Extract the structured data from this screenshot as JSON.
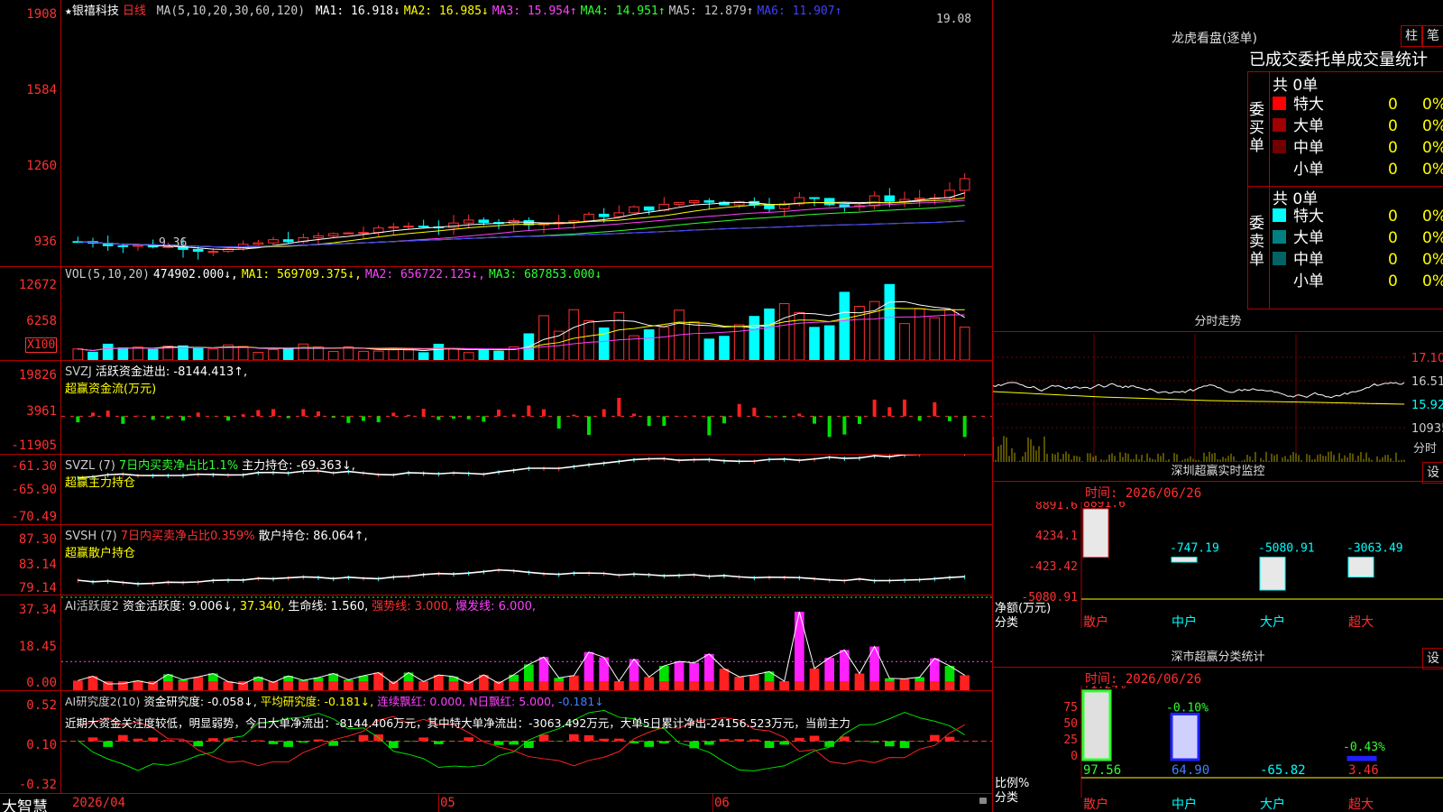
{
  "stock": {
    "name": "★银禧科技",
    "period": "日线",
    "ma_prefix": "MA(5,10,20,30,60,120)",
    "ma_values": [
      {
        "label": "MA1: 16.918↓",
        "color": "#ffffff"
      },
      {
        "label": "MA2: 16.985↓",
        "color": "#ffff00"
      },
      {
        "label": "MA3: 15.954↑",
        "color": "#ff40ff"
      },
      {
        "label": "MA4: 14.951↑",
        "color": "#30ff30"
      },
      {
        "label": "MA5: 12.879↑",
        "color": "#c8c8c8"
      },
      {
        "label": "MA6: 11.907↑",
        "color": "#4040ff"
      }
    ],
    "high_mark": "19.08",
    "low_mark": "9.36",
    "y_ticks": [
      "1908",
      "1584",
      "1260",
      "936"
    ]
  },
  "volume": {
    "legend": [
      {
        "label": "VOL(5,10,20)",
        "color": "#cccccc"
      },
      {
        "label": "474902.000↓,",
        "color": "#ffffff"
      },
      {
        "label": "MA1: 569709.375↓,",
        "color": "#ffff00"
      },
      {
        "label": "MA2: 656722.125↓,",
        "color": "#ff40ff"
      },
      {
        "label": "MA3: 687853.000↓",
        "color": "#30ff30"
      }
    ],
    "y_ticks": [
      "12672",
      "6258"
    ],
    "unit": "X100"
  },
  "svzj": {
    "legend1": [
      {
        "label": "SVZJ",
        "color": "#cccccc"
      },
      {
        "label": "活跃资金进出: -8144.413↑,",
        "color": "#ffffff"
      }
    ],
    "legend2": "超赢资金流(万元)",
    "y_ticks": [
      "19826",
      "3961",
      "-11905"
    ]
  },
  "svzl": {
    "legend1": [
      {
        "label": "SVZL (7)",
        "color": "#cccccc"
      },
      {
        "label": "7日内买卖净占比1.1%",
        "color": "#30ff30"
      },
      {
        "label": "主力持仓: -69.363↓,",
        "color": "#ffffff"
      }
    ],
    "legend2": "超赢主力持仓",
    "y_ticks": [
      "-61.30",
      "-65.90",
      "-70.49"
    ]
  },
  "svsh": {
    "legend1": [
      {
        "label": "SVSH (7)",
        "color": "#cccccc"
      },
      {
        "label": "7日内买卖净占比0.359%",
        "color": "#ff3030"
      },
      {
        "label": "散户持仓: 86.064↑,",
        "color": "#ffffff"
      }
    ],
    "legend2": "超赢散户持仓",
    "y_ticks": [
      "87.30",
      "83.14",
      "79.14"
    ]
  },
  "ai1": {
    "legend": [
      {
        "label": "AI活跃度2",
        "color": "#cccccc"
      },
      {
        "label": "资金活跃度: 9.006↓,",
        "color": "#ffffff"
      },
      {
        "label": "37.340,",
        "color": "#ffff00"
      },
      {
        "label": "生命线: 1.560,",
        "color": "#ffffff"
      },
      {
        "label": "强势线: 3.000,",
        "color": "#ff3030"
      },
      {
        "label": "爆发线: 6.000,",
        "color": "#ff40ff"
      }
    ],
    "y_ticks": [
      "37.34",
      "18.45",
      "0.00"
    ]
  },
  "ai2": {
    "legend": [
      {
        "label": "AI研究度2(10)",
        "color": "#cccccc"
      },
      {
        "label": "资金研究度: -0.058↓,",
        "color": "#ffffff"
      },
      {
        "label": "平均研究度: -0.181↓,",
        "color": "#ffff00"
      },
      {
        "label": "连续飘红: 0.000,",
        "color": "#ff40ff"
      },
      {
        "label": "N日飘红: 5.000,",
        "color": "#ff40ff"
      },
      {
        "label": "-0.181↓",
        "color": "#4080ff"
      }
    ],
    "comment": "近期大资金关注度较低，明显弱势，今日大单净流出：-8144.406万元，其中特大单净流出：-3063.492万元，大单5日累计净出-24156.523万元，当前主力",
    "y_ticks": [
      "0.52",
      "0.10",
      "-0.32"
    ]
  },
  "timeline": {
    "labels": [
      "2026/04",
      "05",
      "06"
    ],
    "brand": "大智慧"
  },
  "dragon_tiger": {
    "title": "龙虎看盘(逐单)",
    "btn1": "柱",
    "btn2": "笔",
    "header": "已成交委托单成交量统计",
    "buy_label": "委买单",
    "sell_label": "委卖单",
    "buy_count": "共 0单",
    "sell_count": "共 0单",
    "buy_rows": [
      {
        "name": "特大",
        "vol": "0",
        "pct": "0%",
        "color": "#ff0000"
      },
      {
        "name": "大单",
        "vol": "0",
        "pct": "0%",
        "color": "#a00000"
      },
      {
        "name": "中单",
        "vol": "0",
        "pct": "0%",
        "color": "#700000"
      },
      {
        "name": "小单",
        "vol": "0",
        "pct": "0%",
        "color": ""
      }
    ],
    "sell_rows": [
      {
        "name": "特大",
        "vol": "0",
        "pct": "0%",
        "color": "#00ffff"
      },
      {
        "name": "大单",
        "vol": "0",
        "pct": "0%",
        "color": "#008080"
      },
      {
        "name": "中单",
        "vol": "0",
        "pct": "0%",
        "color": "#006464"
      },
      {
        "name": "小单",
        "vol": "0",
        "pct": "0%",
        "color": ""
      }
    ]
  },
  "intraday": {
    "title": "分时走势",
    "prices": [
      "17.10",
      "16.51",
      "15.92",
      "10935"
    ],
    "unit": "分时"
  },
  "sz_monitor": {
    "title": "深圳超赢实时监控",
    "btn": "设",
    "date": "时间: 2026/06/26",
    "y_ticks": [
      "8891.6",
      "4234.1",
      "-423.42",
      "-5080.91"
    ],
    "y_unit1": "净额(万元)",
    "y_unit2": "分类",
    "bars": [
      {
        "cat": "散户",
        "value": 8891.6,
        "label": "8891.6"
      },
      {
        "cat": "中户",
        "value": -747.19,
        "label": "-747.19"
      },
      {
        "cat": "大户",
        "value": -5080.91,
        "label": "-5080.91"
      },
      {
        "cat": "超大",
        "value": -3063.49,
        "label": "-3063.49"
      }
    ]
  },
  "sz_class": {
    "title": "深市超赢分类统计",
    "btn": "设",
    "date": "时间: 2026/06/26",
    "y_ticks": [
      "75",
      "50",
      "25",
      "0"
    ],
    "y_unit1": "比例%",
    "y_unit2": "分类",
    "bars": [
      {
        "cat": "散户",
        "value": 97.56,
        "change": "+1.24%",
        "label": "97.56"
      },
      {
        "cat": "中户",
        "value": 64.9,
        "change": "-0.10%",
        "label": "64.90"
      },
      {
        "cat": "大户",
        "value": -65.82,
        "change": "",
        "label": "-65.82"
      },
      {
        "cat": "超大",
        "value": 3.46,
        "change": "-0.43%",
        "label": "3.46"
      }
    ]
  }
}
